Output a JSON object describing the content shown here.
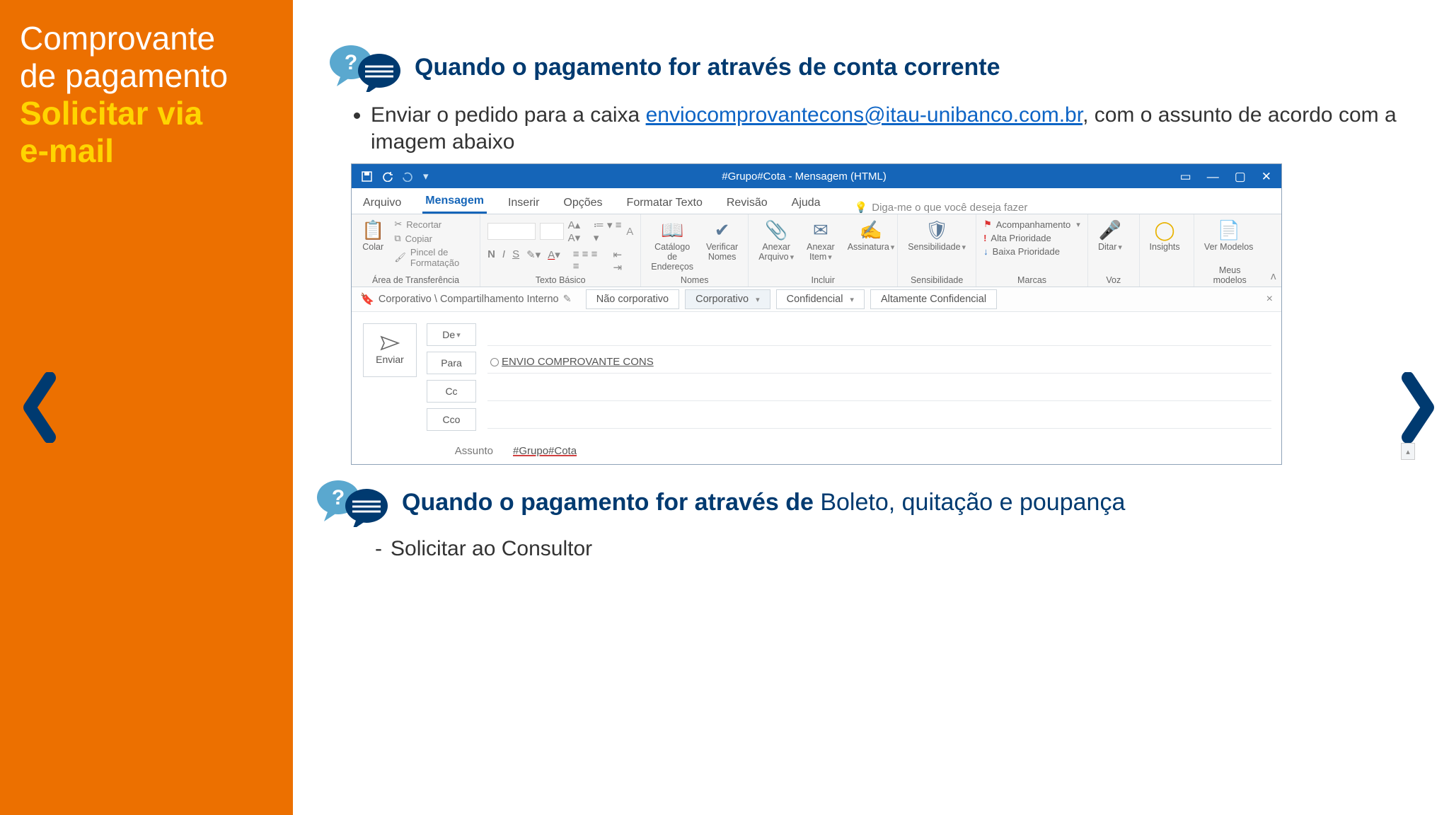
{
  "sidebar": {
    "title_l1": "Comprovante",
    "title_l2": "de pagamento",
    "accent_l1": "Solicitar via",
    "accent_l2": "e-mail"
  },
  "section1": {
    "heading": "Quando o pagamento for através de conta corrente",
    "bullet_pre": "Enviar o pedido para a caixa ",
    "email": "enviocomprovantecons@itau-unibanco.com.br",
    "bullet_post": ", com o assunto de acordo com a imagem abaixo"
  },
  "section2": {
    "heading_bold": "Quando o pagamento for através de ",
    "heading_light": "Boleto, quitação e poupança",
    "dash_item": "Solicitar ao Consultor"
  },
  "outlook": {
    "title": "#Grupo#Cota - Mensagem (HTML)",
    "tabs": [
      "Arquivo",
      "Mensagem",
      "Inserir",
      "Opções",
      "Formatar Texto",
      "Revisão",
      "Ajuda"
    ],
    "active_tab": "Mensagem",
    "tellme": "Diga-me o que você deseja fazer",
    "ribbon": {
      "clipboard": {
        "paste": "Colar",
        "cut": "Recortar",
        "copy": "Copiar",
        "painter": "Pincel de Formatação",
        "group": "Área de Transferência"
      },
      "font": {
        "group": "Texto Básico"
      },
      "names": {
        "addr": "Catálogo de Endereços",
        "check": "Verificar Nomes",
        "group": "Nomes"
      },
      "include": {
        "attach": "Anexar Arquivo",
        "item": "Anexar Item",
        "sign": "Assinatura",
        "group": "Incluir"
      },
      "sens": {
        "btn": "Sensibilidade",
        "group": "Sensibilidade"
      },
      "tags": {
        "follow": "Acompanhamento",
        "high": "Alta Prioridade",
        "low": "Baixa Prioridade",
        "group": "Marcas"
      },
      "voice": {
        "btn": "Ditar",
        "group": "Voz"
      },
      "insights": {
        "btn": "Insights"
      },
      "templates": {
        "btn": "Ver Modelos",
        "group": "Meus modelos"
      }
    },
    "sensbar": {
      "path": "Corporativo \\ Compartilhamento Interno",
      "opts": [
        "Não corporativo",
        "Corporativo",
        "Confidencial",
        "Altamente Confidencial"
      ],
      "active": "Corporativo"
    },
    "compose": {
      "send": "Enviar",
      "from": "De",
      "to": "Para",
      "cc": "Cc",
      "bcc": "Cco",
      "to_value": "ENVIO COMPROVANTE CONS",
      "subject_label": "Assunto",
      "subject_value": "#Grupo#Cota"
    }
  }
}
